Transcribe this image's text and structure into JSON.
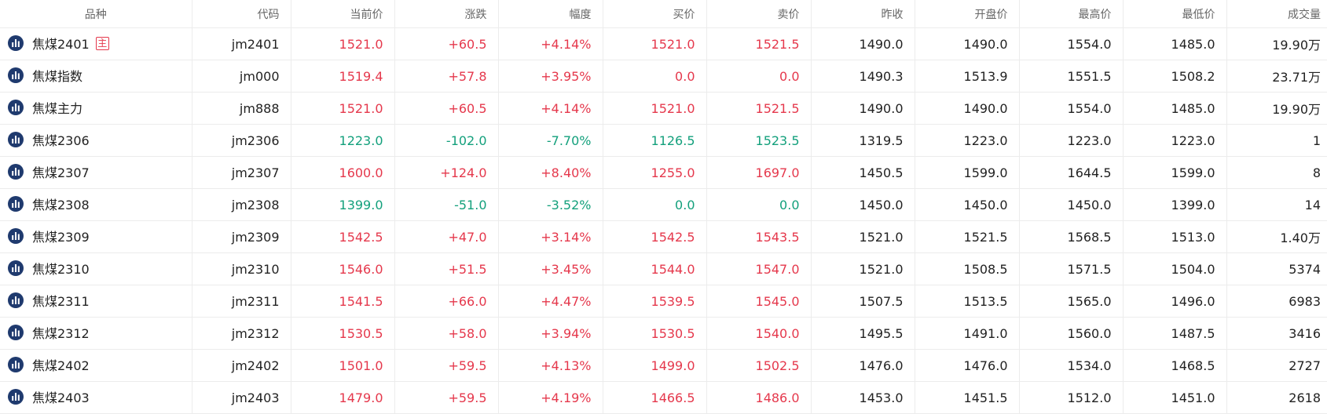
{
  "columns": [
    "品种",
    "代码",
    "当前价",
    "涨跌",
    "幅度",
    "买价",
    "卖价",
    "昨收",
    "开盘价",
    "最高价",
    "最低价",
    "成交量"
  ],
  "colors": {
    "up": "#e5384c",
    "down": "#13a07c",
    "icon": "#1f3a6e"
  },
  "main_badge": "主",
  "rows": [
    {
      "name": "焦煤2401",
      "badge": true,
      "code": "jm2401",
      "price": "1521.0",
      "change": "+60.5",
      "pct": "+4.14%",
      "bid": "1521.0",
      "ask": "1521.5",
      "prev_close": "1490.0",
      "open": "1490.0",
      "high": "1554.0",
      "low": "1485.0",
      "volume": "19.90万",
      "trend": "up"
    },
    {
      "name": "焦煤指数",
      "badge": false,
      "code": "jm000",
      "price": "1519.4",
      "change": "+57.8",
      "pct": "+3.95%",
      "bid": "0.0",
      "ask": "0.0",
      "prev_close": "1490.3",
      "open": "1513.9",
      "high": "1551.5",
      "low": "1508.2",
      "volume": "23.71万",
      "trend": "up"
    },
    {
      "name": "焦煤主力",
      "badge": false,
      "code": "jm888",
      "price": "1521.0",
      "change": "+60.5",
      "pct": "+4.14%",
      "bid": "1521.0",
      "ask": "1521.5",
      "prev_close": "1490.0",
      "open": "1490.0",
      "high": "1554.0",
      "low": "1485.0",
      "volume": "19.90万",
      "trend": "up"
    },
    {
      "name": "焦煤2306",
      "badge": false,
      "code": "jm2306",
      "price": "1223.0",
      "change": "-102.0",
      "pct": "-7.70%",
      "bid": "1126.5",
      "ask": "1523.5",
      "prev_close": "1319.5",
      "open": "1223.0",
      "high": "1223.0",
      "low": "1223.0",
      "volume": "1",
      "trend": "down"
    },
    {
      "name": "焦煤2307",
      "badge": false,
      "code": "jm2307",
      "price": "1600.0",
      "change": "+124.0",
      "pct": "+8.40%",
      "bid": "1255.0",
      "ask": "1697.0",
      "prev_close": "1450.5",
      "open": "1599.0",
      "high": "1644.5",
      "low": "1599.0",
      "volume": "8",
      "trend": "up"
    },
    {
      "name": "焦煤2308",
      "badge": false,
      "code": "jm2308",
      "price": "1399.0",
      "change": "-51.0",
      "pct": "-3.52%",
      "bid": "0.0",
      "ask": "0.0",
      "prev_close": "1450.0",
      "open": "1450.0",
      "high": "1450.0",
      "low": "1399.0",
      "volume": "14",
      "trend": "down"
    },
    {
      "name": "焦煤2309",
      "badge": false,
      "code": "jm2309",
      "price": "1542.5",
      "change": "+47.0",
      "pct": "+3.14%",
      "bid": "1542.5",
      "ask": "1543.5",
      "prev_close": "1521.0",
      "open": "1521.5",
      "high": "1568.5",
      "low": "1513.0",
      "volume": "1.40万",
      "trend": "up"
    },
    {
      "name": "焦煤2310",
      "badge": false,
      "code": "jm2310",
      "price": "1546.0",
      "change": "+51.5",
      "pct": "+3.45%",
      "bid": "1544.0",
      "ask": "1547.0",
      "prev_close": "1521.0",
      "open": "1508.5",
      "high": "1571.5",
      "low": "1504.0",
      "volume": "5374",
      "trend": "up"
    },
    {
      "name": "焦煤2311",
      "badge": false,
      "code": "jm2311",
      "price": "1541.5",
      "change": "+66.0",
      "pct": "+4.47%",
      "bid": "1539.5",
      "ask": "1545.0",
      "prev_close": "1507.5",
      "open": "1513.5",
      "high": "1565.0",
      "low": "1496.0",
      "volume": "6983",
      "trend": "up"
    },
    {
      "name": "焦煤2312",
      "badge": false,
      "code": "jm2312",
      "price": "1530.5",
      "change": "+58.0",
      "pct": "+3.94%",
      "bid": "1530.5",
      "ask": "1540.0",
      "prev_close": "1495.5",
      "open": "1491.0",
      "high": "1560.0",
      "low": "1487.5",
      "volume": "3416",
      "trend": "up"
    },
    {
      "name": "焦煤2402",
      "badge": false,
      "code": "jm2402",
      "price": "1501.0",
      "change": "+59.5",
      "pct": "+4.13%",
      "bid": "1499.0",
      "ask": "1502.5",
      "prev_close": "1476.0",
      "open": "1476.0",
      "high": "1534.0",
      "low": "1468.5",
      "volume": "2727",
      "trend": "up"
    },
    {
      "name": "焦煤2403",
      "badge": false,
      "code": "jm2403",
      "price": "1479.0",
      "change": "+59.5",
      "pct": "+4.19%",
      "bid": "1466.5",
      "ask": "1486.0",
      "prev_close": "1453.0",
      "open": "1451.5",
      "high": "1512.0",
      "low": "1451.0",
      "volume": "2618",
      "trend": "up"
    }
  ]
}
